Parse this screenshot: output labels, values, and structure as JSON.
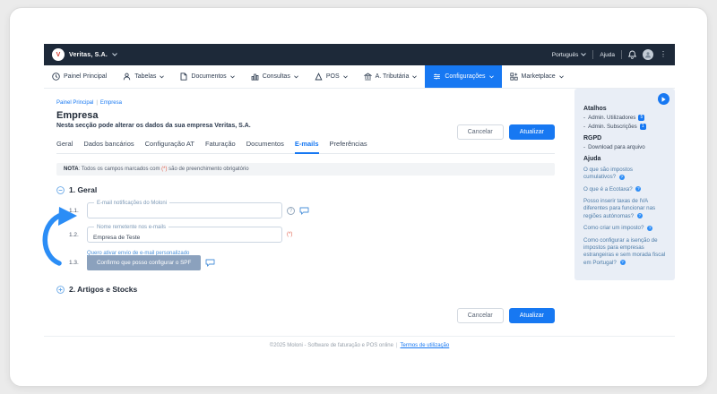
{
  "topbar": {
    "company": "Veritas, S.A.",
    "language": "Português",
    "help": "Ajuda"
  },
  "menu": {
    "items": [
      {
        "label": "Painel Principal",
        "icon": "clock-icon",
        "active": false,
        "dropdown": false
      },
      {
        "label": "Tabelas",
        "icon": "users-icon",
        "active": false,
        "dropdown": true
      },
      {
        "label": "Documentos",
        "icon": "document-icon",
        "active": false,
        "dropdown": true
      },
      {
        "label": "Consultas",
        "icon": "bar-chart-icon",
        "active": false,
        "dropdown": true
      },
      {
        "label": "POS",
        "icon": "pos-triangle-icon",
        "active": false,
        "dropdown": true
      },
      {
        "label": "A. Tributária",
        "icon": "bank-icon",
        "active": false,
        "dropdown": true
      },
      {
        "label": "Configurações",
        "icon": "sliders-icon",
        "active": true,
        "dropdown": true
      },
      {
        "label": "Marketplace",
        "icon": "grid-plus-icon",
        "active": false,
        "dropdown": true
      }
    ]
  },
  "breadcrumb": {
    "item1": "Painel Principal",
    "divider": "|",
    "item2": "Empresa"
  },
  "page": {
    "title": "Empresa",
    "subtitle": "Nesta secção pode alterar os dados da sua empresa Veritas, S.A."
  },
  "tabs": {
    "items": [
      {
        "label": "Geral",
        "active": false
      },
      {
        "label": "Dados bancários",
        "active": false
      },
      {
        "label": "Configuração AT",
        "active": false
      },
      {
        "label": "Faturação",
        "active": false
      },
      {
        "label": "Documentos",
        "active": false
      },
      {
        "label": "E-mails",
        "active": true
      },
      {
        "label": "Preferências",
        "active": false
      }
    ]
  },
  "actions": {
    "cancel": "Cancelar",
    "update": "Atualizar"
  },
  "note": {
    "label": "NOTA",
    "before": ": Todos os campos marcados com ",
    "marker": "(*)",
    "after": " são de preenchimento obrigatório"
  },
  "sections": {
    "s1": {
      "label": "1. Geral",
      "state": "expanded"
    },
    "s2": {
      "label": "2. Artigos e Stocks",
      "state": "collapsed"
    }
  },
  "fields": {
    "f11": {
      "num": "1.1.",
      "label": "E-mail notificações do Moloni",
      "value": ""
    },
    "f12": {
      "num": "1.2.",
      "label": "Nome remetente nos e-mails",
      "value": "Empresa de Teste",
      "required": "(*)"
    },
    "f13": {
      "num": "1.3.",
      "link_label": "Quero ativar envio de e-mail personalizado",
      "button": "Confirmo que posso configurar o SPF"
    }
  },
  "sidebar": {
    "shortcuts_title": "Atalhos",
    "shortcuts": [
      {
        "label": "Admin. Utilizadores",
        "badge": "5"
      },
      {
        "label": "Admin. Subscrições",
        "badge": "1"
      }
    ],
    "rgpd_title": "RGPD",
    "rgpd_items": [
      "Download para arquivo"
    ],
    "help_title": "Ajuda",
    "help_links": [
      "O que são impostos cumulativos?",
      "O que é a Ecotaxa?",
      "Posso inserir taxas de IVA diferentes para funcionar nas regiões autónomas?",
      "Como criar um imposto?",
      "Como configurar a isenção de impostos para empresas estrangeiras e sem morada fiscal em Portugal?"
    ]
  },
  "footer": {
    "text": "©2025 Moloni - Software de faturação e POS online",
    "divider": "|",
    "link": "Termos de utilização"
  },
  "icons": {
    "question_mark": "?",
    "more_dots": "⋮",
    "logo_letter": "V"
  },
  "colors": {
    "accent": "#1778f2",
    "navbar": "#1d2939",
    "sidebar_bg": "#e9eef6",
    "muted_button": "#8ba1bd",
    "required": "#e0604d",
    "annotation_arrow": "#2b8df6"
  }
}
